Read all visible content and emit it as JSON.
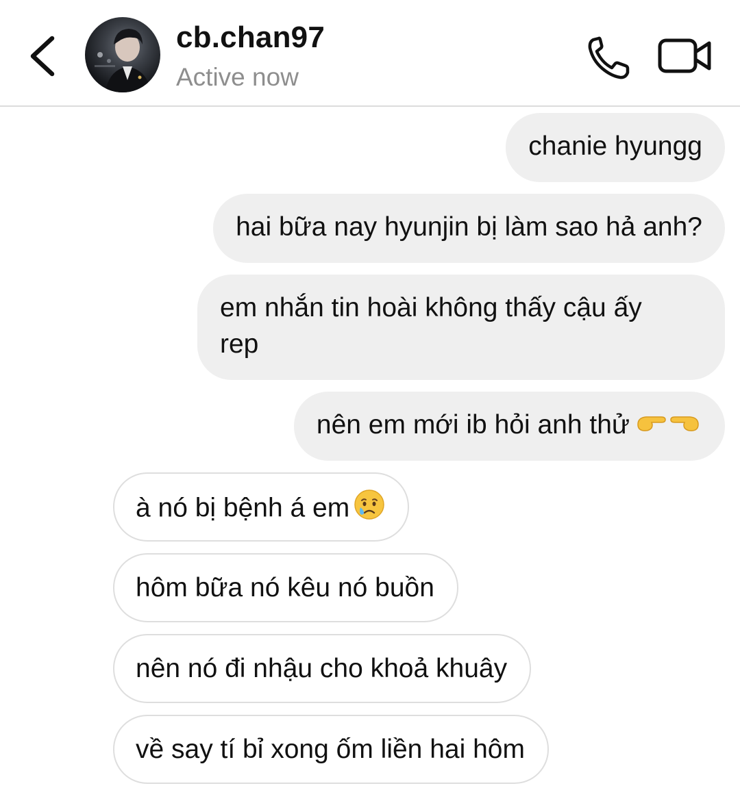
{
  "header": {
    "username": "cb.chan97",
    "status": "Active now",
    "back_icon": "chevron-left-icon",
    "call_icon": "phone-icon",
    "video_icon": "video-camera-icon"
  },
  "messages": [
    {
      "from": "me",
      "text": "chanie hyungg"
    },
    {
      "from": "me",
      "text": "hai bữa nay hyunjin bị làm sao hả anh?"
    },
    {
      "from": "me",
      "line1": "em nhắn tin hoài không thấy cậu ấy",
      "line2": "rep"
    },
    {
      "from": "me",
      "text": "nên em mới ib hỏi anh thử",
      "emoji": "pointing-fingers-emoji"
    },
    {
      "from": "them",
      "text": "à nó bị bệnh á em",
      "emoji": "crying-face-emoji"
    },
    {
      "from": "them",
      "text": "hôm bữa nó kêu nó buồn"
    },
    {
      "from": "them",
      "text": "nên nó đi nhậu cho khoả khuây"
    },
    {
      "from": "them",
      "text": "về say tí bỉ xong ốm liền hai hôm"
    }
  ],
  "colors": {
    "sent_bubble": "#efefef",
    "received_border": "#dedede",
    "status_gray": "#8e8e8e",
    "text": "#111111"
  }
}
